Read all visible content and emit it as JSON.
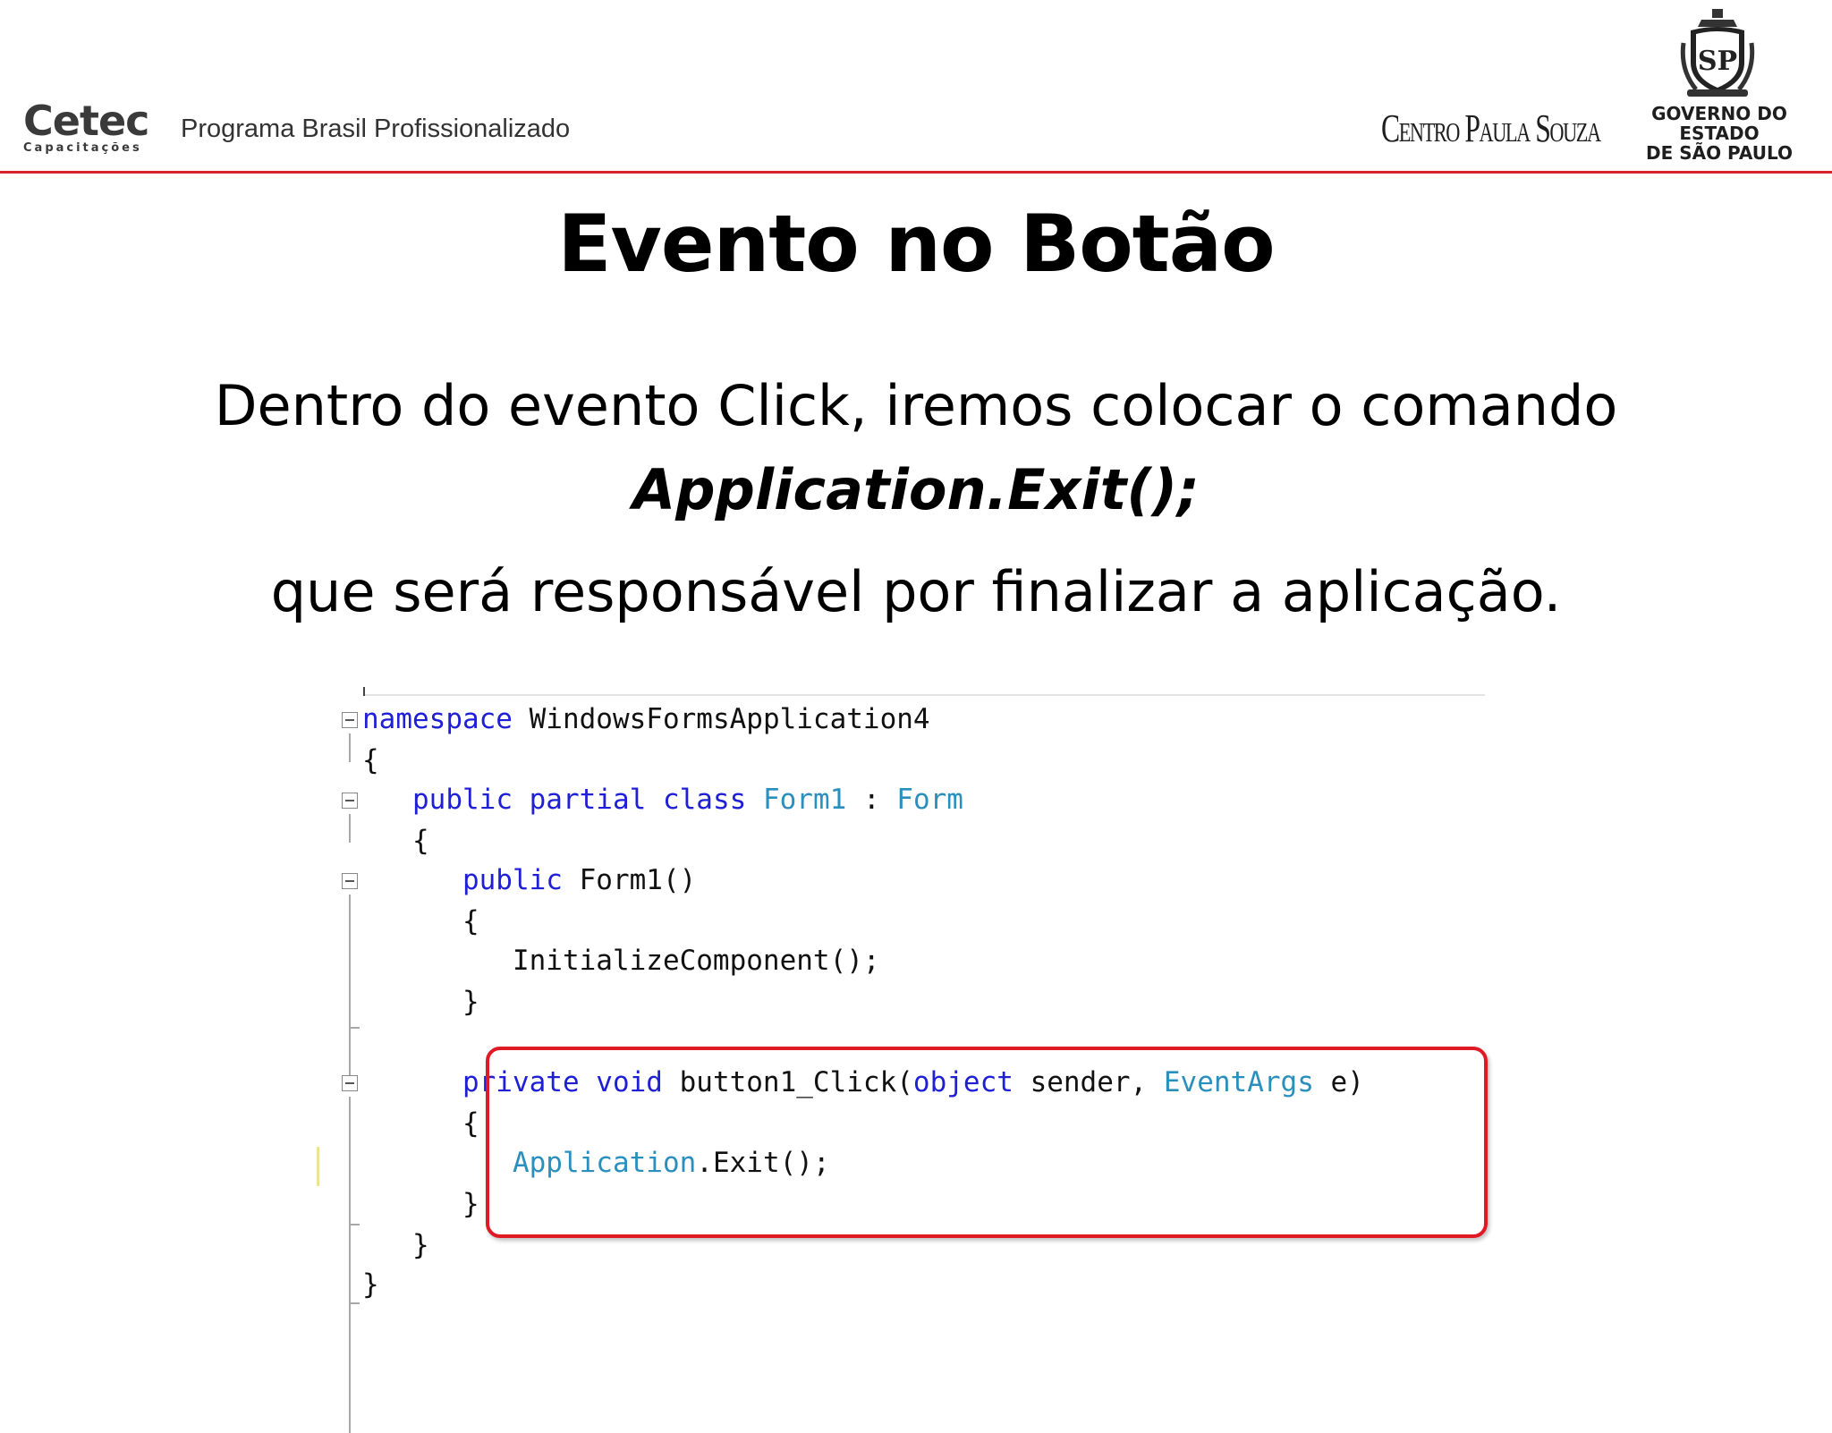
{
  "header": {
    "cetec_logo": {
      "name": "Cetec",
      "sub": "Capacitações"
    },
    "program": "Programa Brasil Profissionalizado",
    "centro_paula_souza": "Centro Paula Souza",
    "governo": {
      "line1": "GOVERNO DO ESTADO",
      "line2": "DE SÃO PAULO"
    },
    "seal_text": "SP",
    "accent_color": "#d9232e"
  },
  "slide": {
    "title": "Evento no Botão",
    "line1": "Dentro do evento Click, iremos colocar o comando",
    "line2": "Application.Exit();",
    "line3": "que será responsável por finalizar a aplicação."
  },
  "code": {
    "colors": {
      "keyword": "#1f1fd6",
      "type": "#2b8fbd",
      "highlight": "#e01a24"
    },
    "l1": {
      "kw": "namespace",
      "rest": " WindowsFormsApplication4"
    },
    "l2": "{",
    "l3": {
      "indent": "   ",
      "kw": "public partial class",
      "sp": " ",
      "ty1": "Form1",
      "mid": " : ",
      "ty2": "Form"
    },
    "l4": "   {",
    "l5": {
      "indent": "      ",
      "kw": "public",
      "rest": " Form1()"
    },
    "l6": "      {",
    "l7": "         InitializeComponent();",
    "l8": "      }",
    "l9": {
      "indent": "      ",
      "kw1": "private void",
      "mid1": " button1_Click(",
      "kw2": "object",
      "mid2": " sender, ",
      "ty": "EventArgs",
      "end": " e)"
    },
    "l10": "      {",
    "l11": {
      "indent": "         ",
      "ty": "Application",
      "rest": ".Exit();"
    },
    "l12": "      }",
    "l13": "   }",
    "l14": "}"
  }
}
